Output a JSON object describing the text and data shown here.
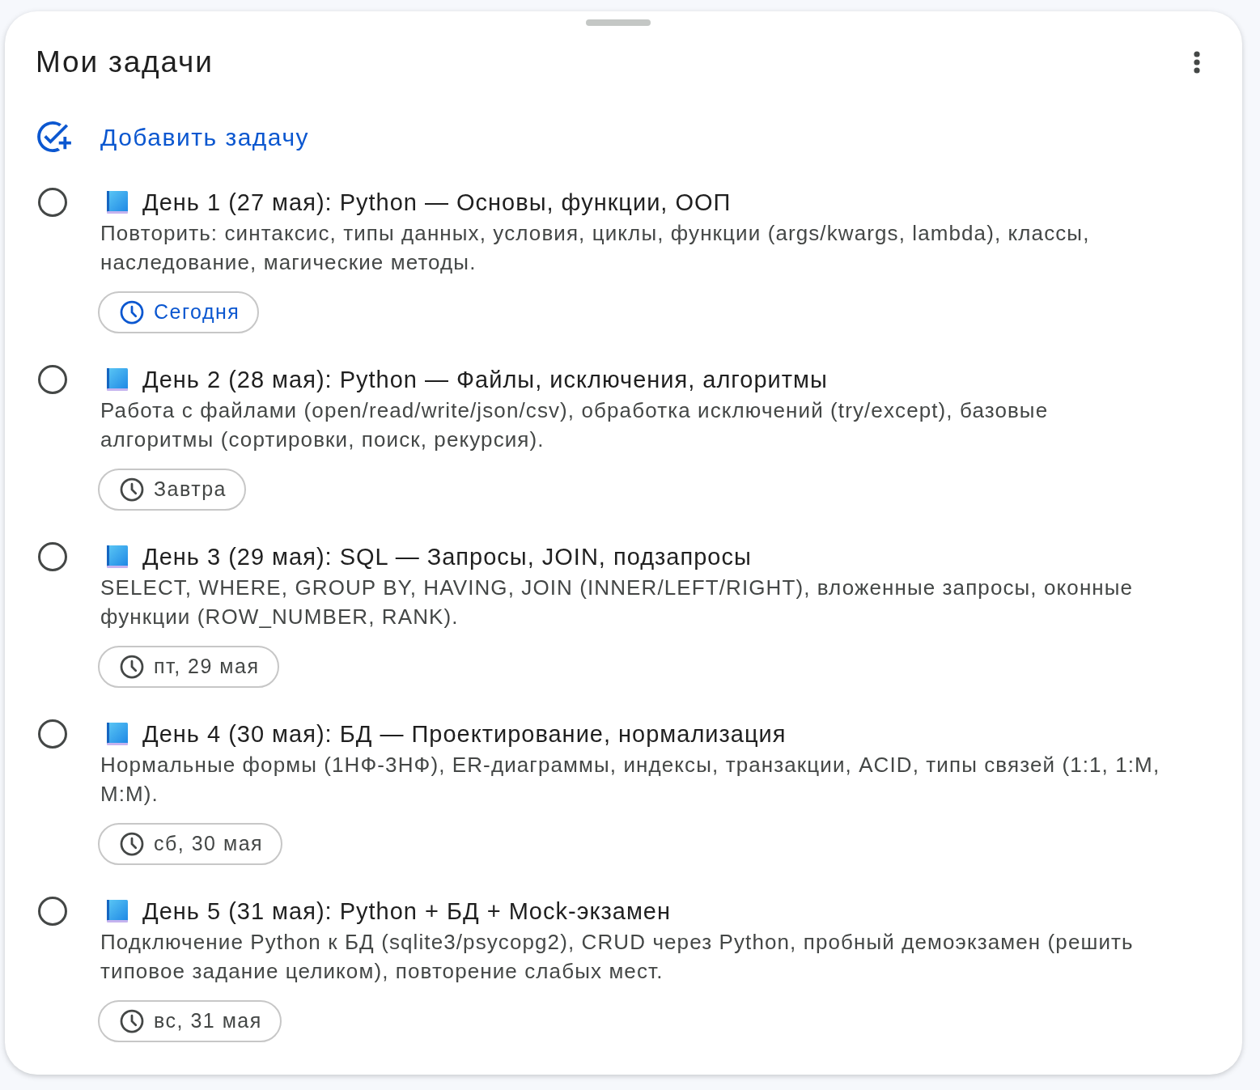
{
  "sheet": {
    "title": "Мои задачи"
  },
  "add_task": {
    "label": "Добавить задачу"
  },
  "tasks": [
    {
      "title": "День 1 (27 мая): Python — Основы, функции, ООП",
      "completed": false,
      "description": "Повторить: синтаксис, типы данных, условия, циклы, функции (args/kwargs, lambda), классы, наследование, магические методы.",
      "due": {
        "label": "Сегодня",
        "today": true
      }
    },
    {
      "title": "День 2 (28 мая): Python — Файлы, исключения, алгоритмы",
      "completed": false,
      "description": "Работа с файлами (open/read/write/json/csv), обработка исключений (try/except), базовые алгоритмы (сортировки, поиск, рекурсия).",
      "due": {
        "label": "Завтра",
        "today": false
      }
    },
    {
      "title": "День 3 (29 мая): SQL — Запросы, JOIN, подзапросы",
      "completed": false,
      "description": "SELECT, WHERE, GROUP BY, HAVING, JOIN (INNER/LEFT/RIGHT), вложенные запросы, оконные функции (ROW_NUMBER, RANK).",
      "due": {
        "label": "пт, 29 мая",
        "today": false
      }
    },
    {
      "title": "День 4 (30 мая): БД — Проектирование, нормализация",
      "completed": false,
      "description": "Нормальные формы (1НФ-3НФ), ER-диаграммы, индексы, транзакции, ACID, типы связей (1:1, 1:M, M:M).",
      "due": {
        "label": "сб, 30 мая",
        "today": false
      }
    },
    {
      "title": "День 5 (31 мая): Python + БД + Mock-экзамен",
      "completed": false,
      "description": "Подключение Python к БД (sqlite3/psycopg2), CRUD через Python, пробный демоэкзамен (решить типовое задание целиком), повторение слабых мест.",
      "due": {
        "label": "вс, 31 мая",
        "today": false
      }
    }
  ]
}
